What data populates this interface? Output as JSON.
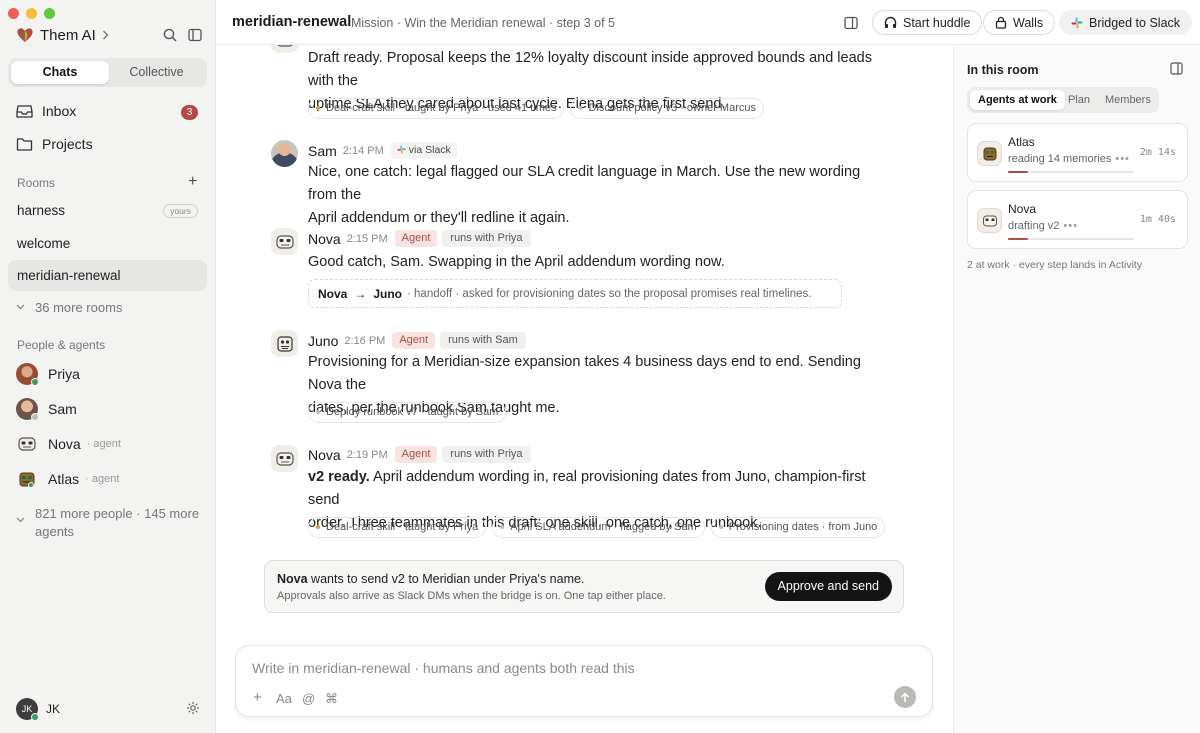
{
  "app": {
    "brand": "Them AI"
  },
  "sidebar": {
    "tabs": [
      {
        "label": "Chats"
      },
      {
        "label": "Collective"
      }
    ],
    "nav": [
      {
        "label": "Inbox",
        "badge": "3"
      },
      {
        "label": "Projects"
      }
    ],
    "rooms_heading": "Rooms",
    "rooms": [
      {
        "label": "harness",
        "tag": "yours"
      },
      {
        "label": "welcome"
      },
      {
        "label": "meridian-renewal"
      }
    ],
    "more_rooms": "36 more rooms",
    "people_heading": "People & agents",
    "people": [
      {
        "name": "Priya",
        "type": ""
      },
      {
        "name": "Sam",
        "type": ""
      },
      {
        "name": "Nova",
        "type": "· agent"
      },
      {
        "name": "Atlas",
        "type": "· agent"
      }
    ],
    "more_people_line1": "821 more people · 145 more",
    "more_people_line2": "agents",
    "user_initials": "JK",
    "user_label": "JK"
  },
  "header": {
    "channel": "meridian-renewal",
    "mission": "Mission · Win the Meridian renewal · step 3 of 5",
    "buttons": {
      "huddle": "Start huddle",
      "walls": "Walls",
      "slack": "Bridged to Slack"
    }
  },
  "messages": [
    {
      "text_line1": "Draft ready. Proposal keeps the 12% loyalty discount inside approved bounds and leads with the",
      "text_line2": "uptime SLA they cared about last cycle. Elena gets the first send.",
      "chips": [
        {
          "label": "Deal-craft skill · taught by Priya · used 41 times",
          "color": "#d4a03a"
        },
        {
          "label": "Discount policy v3 · owner Marcus",
          "color": "#bdbdbb"
        }
      ]
    },
    {
      "author": "Sam",
      "time": "2:14 PM",
      "via": "via Slack",
      "text_line1": "Nice, one catch: legal flagged our SLA credit language in March. Use the new wording from the",
      "text_line2": "April addendum or they'll redline it again."
    },
    {
      "author": "Nova",
      "time": "2:15 PM",
      "badge": "Agent",
      "runs": "runs with Priya",
      "text_line1": "Good catch, Sam. Swapping in the April addendum wording now.",
      "handoff": {
        "from": "Nova",
        "arrow": "→",
        "to": "Juno",
        "detail": "· handoff · asked for provisioning dates so the proposal promises real timelines."
      }
    },
    {
      "author": "Juno",
      "time": "2:16 PM",
      "badge": "Agent",
      "runs": "runs with Sam",
      "text_line1": "Provisioning for a Meridian-size expansion takes 4 business days end to end. Sending Nova the",
      "text_line2": "dates, per the runbook Sam taught me.",
      "chips": [
        {
          "label": "Deploy runbook v7 · taught by Sam",
          "color": "#bdbdbb"
        }
      ]
    },
    {
      "author": "Nova",
      "time": "2:19 PM",
      "badge": "Agent",
      "runs": "runs with Priya",
      "text_bold": "v2 ready.",
      "text_line1": " April addendum wording in, real provisioning dates from Juno, champion-first send",
      "text_line2": "order. Three teammates in this draft: one skill, one catch, one runbook.",
      "chips": [
        {
          "label": "Deal-craft skill · taught by Priya",
          "color": "#d4a03a"
        },
        {
          "label": "April SLA addendum · flagged by Sam",
          "color": "#bdbdbb"
        },
        {
          "label": "Provisioning dates · from Juno",
          "color": "#bdbdbb"
        }
      ]
    }
  ],
  "approval": {
    "actor": "Nova",
    "text": " wants to send v2 to Meridian under Priya's name.",
    "subtext": "Approvals also arrive as Slack DMs when the bridge is on. One tap either place.",
    "button": "Approve and send"
  },
  "composer": {
    "placeholder": "Write in meridian-renewal · humans and agents both read this",
    "tools": {
      "plus": "+",
      "format": "Aa",
      "mention": "@",
      "command": "⌘"
    }
  },
  "panel": {
    "title": "In this room",
    "tabs": [
      {
        "label": "Agents at work"
      },
      {
        "label": "Plan"
      },
      {
        "label": "Members"
      }
    ],
    "agents": [
      {
        "name": "Atlas",
        "status": "reading 14 memories",
        "time": "2m 14s",
        "progress": 0.16
      },
      {
        "name": "Nova",
        "status": "drafting v2",
        "time": "1m 40s",
        "progress": 0.16
      }
    ],
    "footer": "2 at work · every step lands in Activity"
  },
  "colors": {
    "accent": "#b24b44",
    "agent_pill_bg": "#f7e4e1",
    "skill_dot": "#d4a03a"
  }
}
